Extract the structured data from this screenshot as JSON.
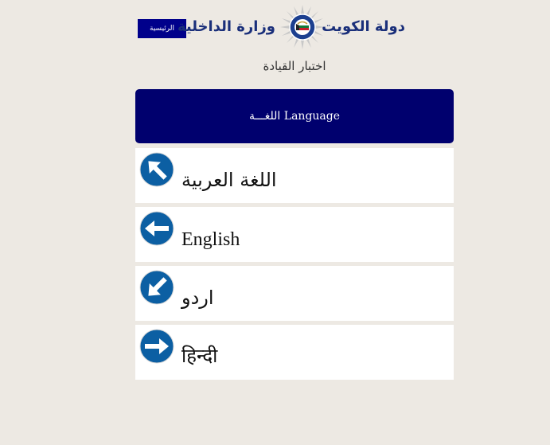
{
  "header": {
    "home_label": "الرئيسية",
    "ministry": "وزارة الداخلية",
    "state": "دولة الكويت",
    "emblem_icon": "kuwait-police-emblem-icon"
  },
  "subtitle": "اختبار القيادة",
  "banner": {
    "label": "اللغـــة  Language"
  },
  "languages": [
    {
      "label": "اللغة العربية",
      "icon": "arrow-up-left-icon"
    },
    {
      "label": "English",
      "icon": "arrow-left-icon"
    },
    {
      "label": "اردو",
      "icon": "arrow-down-left-icon"
    },
    {
      "label": "हिन्दी",
      "icon": "arrow-right-icon"
    }
  ],
  "colors": {
    "background": "#ede9e3",
    "navy": "#00006e",
    "sign_blue": "#0c5fa3",
    "title_blue": "#1a2f7a"
  }
}
